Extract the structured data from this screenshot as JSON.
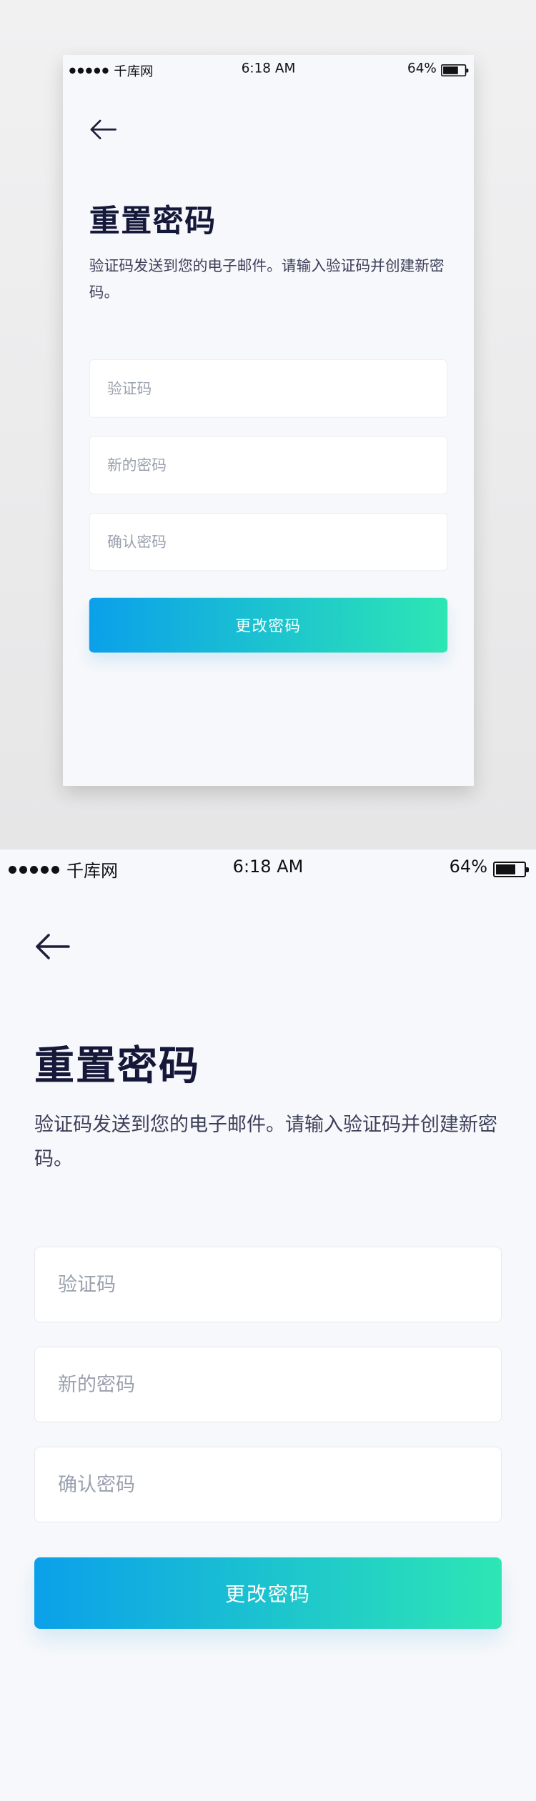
{
  "status_bar": {
    "carrier": "千库网",
    "time": "6:18 AM",
    "battery": "64%"
  },
  "icons": {
    "back": "arrow-left-icon",
    "signal": "signal-dots-icon",
    "battery": "battery-icon"
  },
  "page": {
    "title": "重置密码",
    "description": "验证码发送到您的电子邮件。请输入验证码并创建新密码。"
  },
  "form": {
    "code_placeholder": "验证码",
    "new_password_placeholder": "新的密码",
    "confirm_password_placeholder": "确认密码",
    "submit_label": "更改密码"
  },
  "colors": {
    "gradient_start": "#0ba0ea",
    "gradient_end": "#2de6b4",
    "title": "#151838",
    "placeholder": "#9aa0ae"
  }
}
